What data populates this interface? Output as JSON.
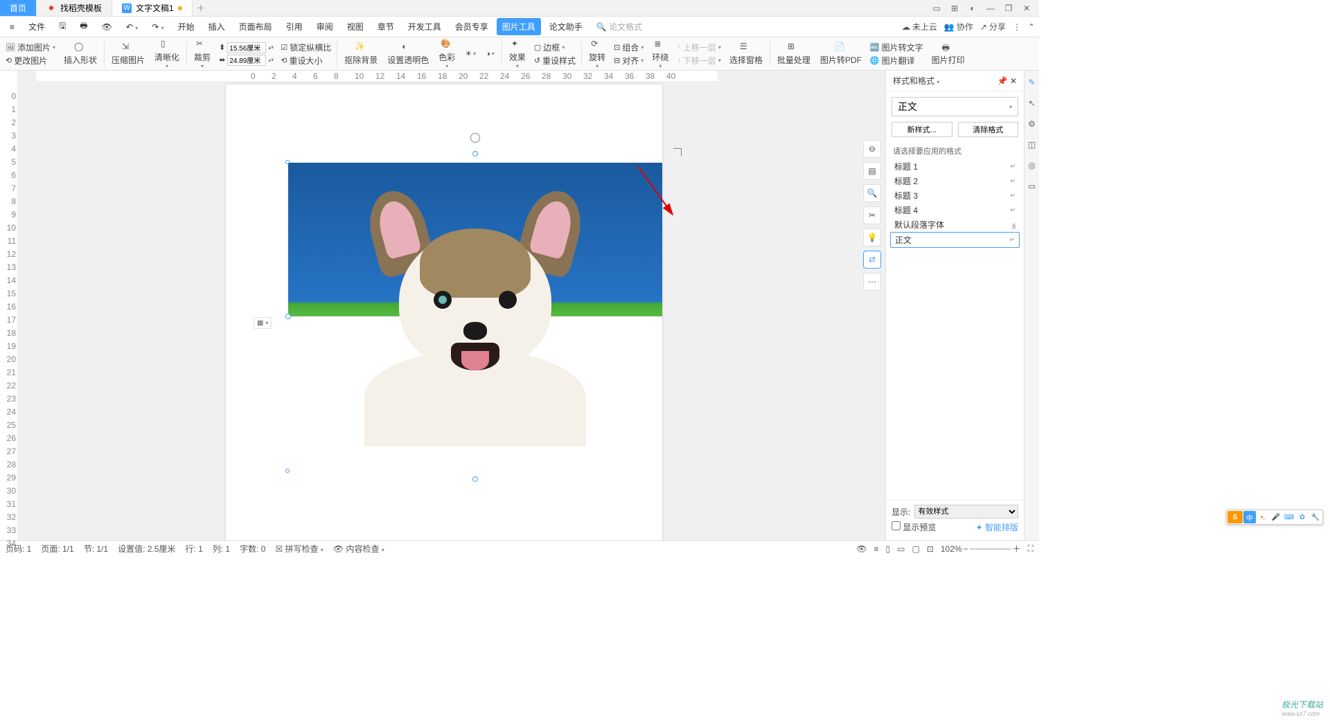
{
  "tabs": {
    "t0": "首页",
    "t1": "找稻壳模板",
    "t2": "文字文稿1"
  },
  "winctrl_icons": [
    "layout",
    "grid",
    "user",
    "min",
    "max",
    "close"
  ],
  "file_label": "文件",
  "menus": [
    "开始",
    "插入",
    "页面布局",
    "引用",
    "审阅",
    "视图",
    "章节",
    "开发工具",
    "会员专享"
  ],
  "menu_active": "图片工具",
  "menu_tail": "论文助手",
  "search_placeholder": "论文格式",
  "topright": {
    "cloud": "未上云",
    "collab": "协作",
    "share": "分享"
  },
  "ribbon": {
    "add_img": "添加图片",
    "change_img": "更改图片",
    "insert_shape": "插入形状",
    "compress": "压缩图片",
    "clarity": "清晰化",
    "crop": "裁剪",
    "w_val": "15.56厘米",
    "h_val": "24.89厘米",
    "lock": "锁定纵横比",
    "reset_size": "重设大小",
    "remove_bg": "抠除背景",
    "transparency": "设置透明色",
    "color": "色彩",
    "effect": "效果",
    "border": "边框",
    "reset_style": "重设样式",
    "rotate": "旋转",
    "align": "对齐",
    "wrap": "环绕",
    "group": "组合",
    "up": "上移一层",
    "down": "下移一层",
    "sel_pane": "选择窗格",
    "batch": "批量处理",
    "to_pdf": "图片转PDF",
    "to_text": "图片转文字",
    "translate": "图片翻译",
    "print": "图片打印"
  },
  "float_tools": [
    "compress",
    "layout",
    "zoom",
    "crop",
    "bulb",
    "convert",
    "more"
  ],
  "panel": {
    "title": "样式和格式",
    "current": "正文",
    "new_btn": "新样式...",
    "clear_btn": "清除格式",
    "hint": "请选择要应用的格式",
    "items": [
      "标题 1",
      "标题 2",
      "标题 3",
      "标题 4",
      "默认段落字体",
      "正文"
    ],
    "show_label": "显示:",
    "show_val": "有效样式",
    "preview": "显示预览",
    "smart": "智能排版"
  },
  "status": {
    "pg_label": "页码: 1",
    "pages": "页面: 1/1",
    "section": "节: 1/1",
    "pos": "设置值: 2.5厘米",
    "line": "行: 1",
    "col": "列: 1",
    "chars": "字数: 0",
    "spell": "拼写检查",
    "content": "内容检查",
    "zoom": "102%"
  },
  "watermark": {
    "main": "极光下载站",
    "sub": "www.xz7.com"
  },
  "lang_cn": "中"
}
